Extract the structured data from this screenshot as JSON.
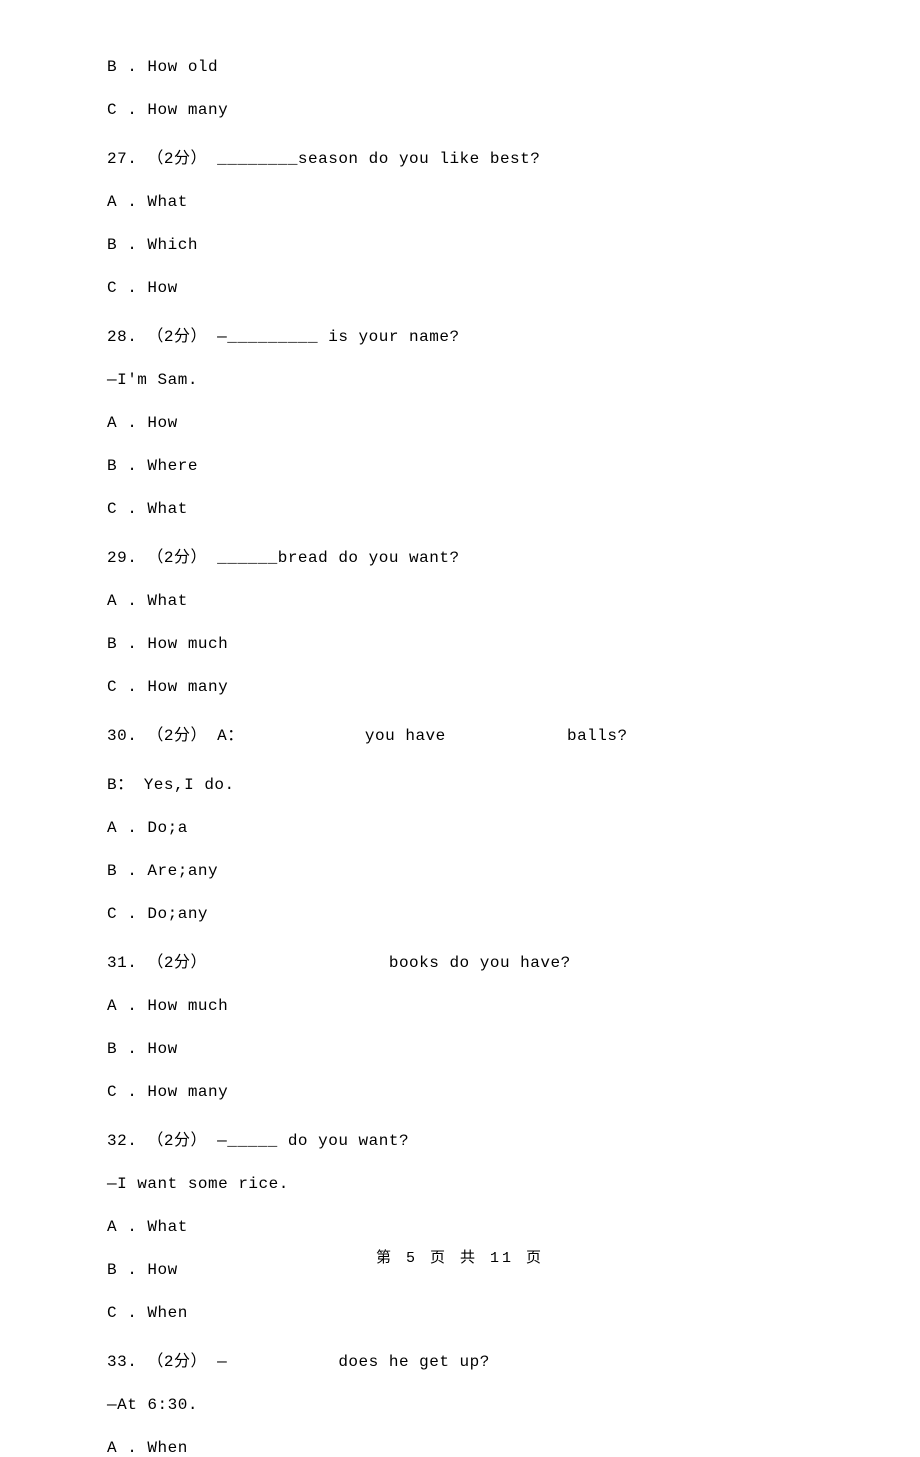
{
  "lines": {
    "l0": "B . How old",
    "l1": "C . How many",
    "l2": "27. （2分） ________season do you like best?",
    "l3": "A . What",
    "l4": "B . Which",
    "l5": "C . How",
    "l6": "28. （2分） —_________ is your name?",
    "l7": "—I'm Sam.",
    "l8": "A . How",
    "l9": "B . Where",
    "l10": "C . What",
    "l11": "29. （2分） ______bread do you want?",
    "l12": "A . What",
    "l13": "B . How much",
    "l14": "C . How many",
    "l15": "30. （2分） A：            you have            balls?",
    "l16": "B： Yes,I do.",
    "l17": "A . Do;a",
    "l18": "B . Are;any",
    "l19": "C . Do;any",
    "l20": "31. （2分）                  books do you have?",
    "l21": "A . How much",
    "l22": "B . How",
    "l23": "C . How many",
    "l24": "32. （2分） —_____ do you want?",
    "l25": "—I want some rice.",
    "l26": "A . What",
    "l27": "B . How",
    "l28": "C . When",
    "l29": "33. （2分） —           does he get up?",
    "l30": "—At 6:30.",
    "l31": "A . When"
  },
  "footer": "第 5 页 共 11 页"
}
